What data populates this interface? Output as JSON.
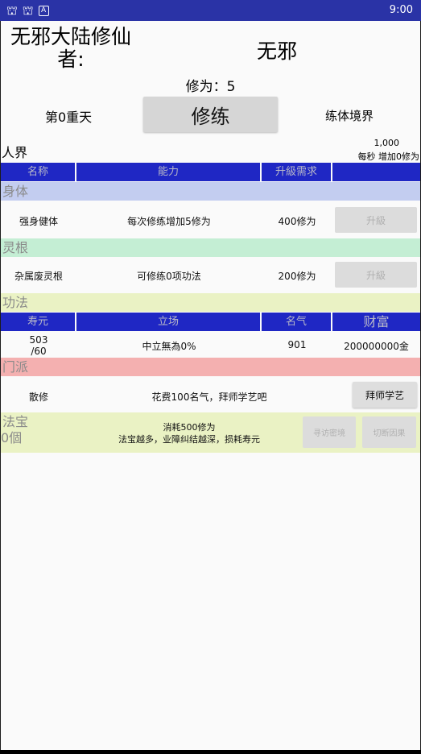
{
  "status_bar": {
    "time": "9:00",
    "icons": [
      "bug-icon",
      "bug-icon",
      "a-icon"
    ]
  },
  "header": {
    "title_left": "无邪大陆修仙者:",
    "title_right": "无邪",
    "cultivation_label": "修为：5"
  },
  "controls": {
    "day_label": "第0重天",
    "cultivate_button": "修练",
    "realm_label": "练体境界"
  },
  "world": {
    "name": "人界",
    "rate_value": "1,000",
    "rate_text": "每秒 增加0修为"
  },
  "table_header": {
    "name": "名称",
    "ability": "能力",
    "upgrade": "升級需求",
    "action": ""
  },
  "body_section": {
    "title": "身体",
    "item_name": "强身健体",
    "ability": "每次修练增加5修为",
    "cost": "400修为",
    "button": "升級"
  },
  "root_section": {
    "title": "灵根",
    "item_name": "杂属废灵根",
    "ability": "可修练0项功法",
    "cost": "200修为",
    "button": "升級"
  },
  "technique_section": {
    "title": "功法"
  },
  "stats_header": {
    "lifespan": "寿元",
    "stance": "立场",
    "fame": "名气",
    "wealth": "财富"
  },
  "stats_row": {
    "lifespan_line1": "503",
    "lifespan_line2": "/60",
    "stance": "中立無為0%",
    "fame": "901",
    "wealth": "200000000金"
  },
  "sect_section": {
    "title": "门派",
    "sect_name": "散修",
    "cost_text": "花费100名气，拜师学艺吧",
    "button": "拜师学艺"
  },
  "treasure_section": {
    "title": "法宝",
    "count": "0個",
    "line1": "消耗500修为",
    "line2": "法宝越多，业障纠结越深，损耗寿元",
    "search_button": "寻访密境",
    "cut_button": "切断因果"
  },
  "colors": {
    "status_bar": "#2a33a6",
    "table_header": "#1f27c4",
    "body_band": "#c3cdf0",
    "root_band": "#c4eed4",
    "technique_band": "#eaf2c4",
    "sect_band": "#f4b0b0",
    "treasure_band": "#eaf2c4"
  }
}
